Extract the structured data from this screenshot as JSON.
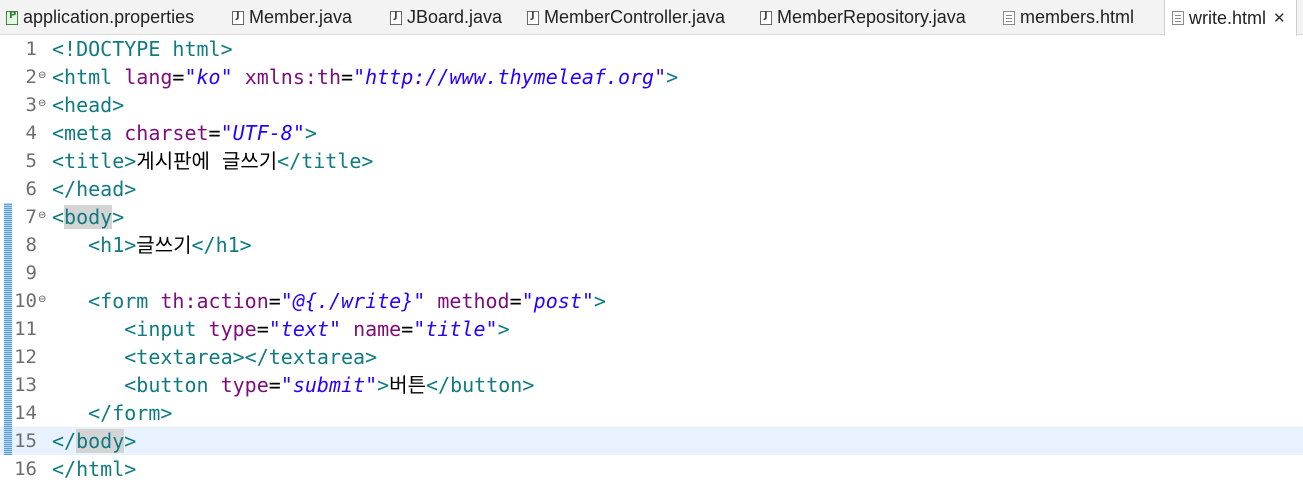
{
  "tabs": [
    {
      "label": "application.properties",
      "icon": "properties-file-icon"
    },
    {
      "label": "Member.java",
      "icon": "java-file-icon"
    },
    {
      "label": "JBoard.java",
      "icon": "java-file-icon"
    },
    {
      "label": "MemberController.java",
      "icon": "java-file-icon"
    },
    {
      "label": "MemberRepository.java",
      "icon": "java-file-icon"
    },
    {
      "label": "members.html",
      "icon": "html-file-icon"
    },
    {
      "label": "write.html",
      "icon": "html-file-icon",
      "active": true,
      "close": "✕"
    }
  ],
  "editor": {
    "current_line": 15,
    "lines": [
      {
        "n": "1",
        "fold": "",
        "segments": [
          {
            "t": "<!DOCTYPE html>",
            "c": "tag"
          }
        ]
      },
      {
        "n": "2",
        "fold": "⊖",
        "segments": [
          {
            "t": "<html ",
            "c": "tag"
          },
          {
            "t": "lang",
            "c": "attr"
          },
          {
            "t": "=",
            "c": "txt"
          },
          {
            "t": "\"ko\"",
            "c": "val"
          },
          {
            "t": " ",
            "c": "txt"
          },
          {
            "t": "xmlns:th",
            "c": "attr"
          },
          {
            "t": "=",
            "c": "txt"
          },
          {
            "t": "\"http://www.thymeleaf.org\"",
            "c": "val"
          },
          {
            "t": ">",
            "c": "tag"
          }
        ]
      },
      {
        "n": "3",
        "fold": "⊖",
        "segments": [
          {
            "t": "<head>",
            "c": "tag"
          }
        ]
      },
      {
        "n": "4",
        "fold": "",
        "segments": [
          {
            "t": "<meta ",
            "c": "tag"
          },
          {
            "t": "charset",
            "c": "attr"
          },
          {
            "t": "=",
            "c": "txt"
          },
          {
            "t": "\"UTF-8\"",
            "c": "val"
          },
          {
            "t": ">",
            "c": "tag"
          }
        ]
      },
      {
        "n": "5",
        "fold": "",
        "segments": [
          {
            "t": "<title>",
            "c": "tag"
          },
          {
            "t": "게시판에 글쓰기",
            "c": "txt"
          },
          {
            "t": "</title>",
            "c": "tag"
          }
        ]
      },
      {
        "n": "6",
        "fold": "",
        "segments": [
          {
            "t": "</head>",
            "c": "tag"
          }
        ]
      },
      {
        "n": "7",
        "fold": "⊖",
        "bar": true,
        "segments": [
          {
            "t": "<",
            "c": "tag"
          },
          {
            "t": "body",
            "c": "tag sel"
          },
          {
            "t": ">",
            "c": "tag"
          }
        ]
      },
      {
        "n": "8",
        "fold": "",
        "bar": true,
        "segments": [
          {
            "t": "   ",
            "c": "txt"
          },
          {
            "t": "<h1>",
            "c": "tag"
          },
          {
            "t": "글쓰기",
            "c": "txt"
          },
          {
            "t": "</h1>",
            "c": "tag"
          }
        ]
      },
      {
        "n": "9",
        "fold": "",
        "bar": true,
        "segments": []
      },
      {
        "n": "10",
        "fold": "⊖",
        "bar": true,
        "segments": [
          {
            "t": "   ",
            "c": "txt"
          },
          {
            "t": "<form ",
            "c": "tag"
          },
          {
            "t": "th:action",
            "c": "attr"
          },
          {
            "t": "=",
            "c": "txt"
          },
          {
            "t": "\"@{./write}\"",
            "c": "val"
          },
          {
            "t": " ",
            "c": "txt"
          },
          {
            "t": "method",
            "c": "attr"
          },
          {
            "t": "=",
            "c": "txt"
          },
          {
            "t": "\"post\"",
            "c": "val"
          },
          {
            "t": ">",
            "c": "tag"
          }
        ]
      },
      {
        "n": "11",
        "fold": "",
        "bar": true,
        "segments": [
          {
            "t": "      ",
            "c": "txt"
          },
          {
            "t": "<input ",
            "c": "tag"
          },
          {
            "t": "type",
            "c": "attr"
          },
          {
            "t": "=",
            "c": "txt"
          },
          {
            "t": "\"text\"",
            "c": "val"
          },
          {
            "t": " ",
            "c": "txt"
          },
          {
            "t": "name",
            "c": "attr"
          },
          {
            "t": "=",
            "c": "txt"
          },
          {
            "t": "\"title\"",
            "c": "val"
          },
          {
            "t": ">",
            "c": "tag"
          }
        ]
      },
      {
        "n": "12",
        "fold": "",
        "bar": true,
        "segments": [
          {
            "t": "      ",
            "c": "txt"
          },
          {
            "t": "<textarea></textarea>",
            "c": "tag"
          }
        ]
      },
      {
        "n": "13",
        "fold": "",
        "bar": true,
        "segments": [
          {
            "t": "      ",
            "c": "txt"
          },
          {
            "t": "<button ",
            "c": "tag"
          },
          {
            "t": "type",
            "c": "attr"
          },
          {
            "t": "=",
            "c": "txt"
          },
          {
            "t": "\"submit\"",
            "c": "val"
          },
          {
            "t": ">",
            "c": "tag"
          },
          {
            "t": "버튼",
            "c": "txt"
          },
          {
            "t": "</button>",
            "c": "tag"
          }
        ]
      },
      {
        "n": "14",
        "fold": "",
        "bar": true,
        "segments": [
          {
            "t": "   ",
            "c": "txt"
          },
          {
            "t": "</form>",
            "c": "tag"
          }
        ]
      },
      {
        "n": "15",
        "fold": "",
        "bar": true,
        "segments": [
          {
            "t": "</",
            "c": "tag"
          },
          {
            "t": "body",
            "c": "tag sel"
          },
          {
            "t": ">",
            "c": "tag"
          }
        ]
      },
      {
        "n": "16",
        "fold": "",
        "segments": [
          {
            "t": "</html>",
            "c": "tag"
          }
        ]
      }
    ]
  }
}
